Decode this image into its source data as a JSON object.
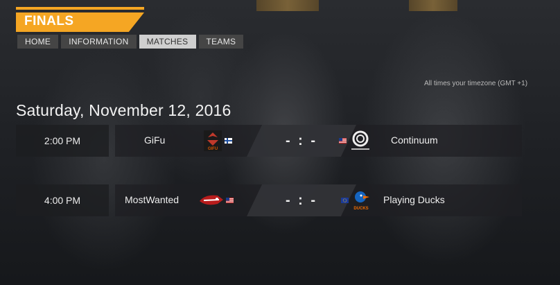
{
  "header": {
    "title": "FINALS"
  },
  "nav": [
    {
      "label": "HOME"
    },
    {
      "label": "INFORMATION"
    },
    {
      "label": "MATCHES",
      "active": true
    },
    {
      "label": "TEAMS"
    }
  ],
  "timezone_note": "All times your timezone (GMT +1)",
  "date": "Saturday, November 12, 2016",
  "matches": [
    {
      "time": "2:00 PM",
      "team1": {
        "name": "GiFu",
        "logo": "gifu-logo",
        "flag": "finland-flag"
      },
      "score": "- : -",
      "team2": {
        "name": "Continuum",
        "logo": "continuum-logo",
        "flag": "usa-flag"
      }
    },
    {
      "time": "4:00 PM",
      "team1": {
        "name": "MostWanted",
        "logo": "mostwanted-logo",
        "flag": "usa-flag"
      },
      "score": "- : -",
      "team2": {
        "name": "Playing Ducks",
        "logo": "playing-ducks-logo",
        "flag": "eu-flag"
      }
    }
  ],
  "colors": {
    "accent": "#f5a623",
    "nav_bg": "#454545",
    "nav_active": "#cfcfcf"
  }
}
